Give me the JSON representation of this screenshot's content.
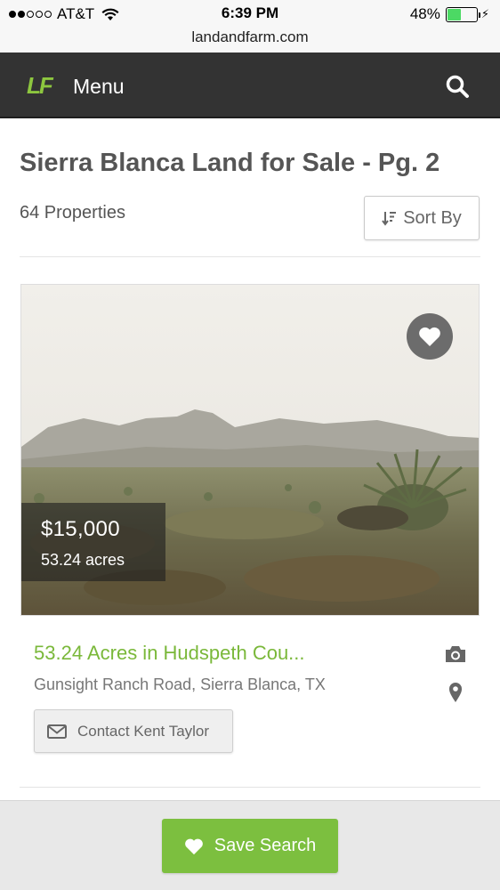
{
  "status_bar": {
    "carrier": "AT&T",
    "time": "6:39 PM",
    "battery_percent": "48%",
    "battery_level": 0.48,
    "signal_bars": 2
  },
  "browser": {
    "url": "landandfarm.com"
  },
  "nav": {
    "logo": "LF",
    "menu_label": "Menu",
    "search_icon": "search-icon"
  },
  "header": {
    "title": "Sierra Blanca Land for Sale - Pg. 2",
    "count": "64 Properties",
    "sort_label": "Sort By"
  },
  "listing": {
    "price": "$15,000",
    "acres": "53.24 acres",
    "title": "53.24 Acres in Hudspeth Cou...",
    "address": "Gunsight Ranch Road, Sierra Blanca, TX",
    "contact_label": "Contact Kent Taylor",
    "favorite_icon": "heart-icon",
    "photo_icon": "camera-icon",
    "map_icon": "map-pin-icon"
  },
  "footer": {
    "save_label": "Save Search"
  },
  "colors": {
    "accent_green": "#7cbf3f",
    "nav_bg": "#333333",
    "title_green": "#7ab83a"
  }
}
